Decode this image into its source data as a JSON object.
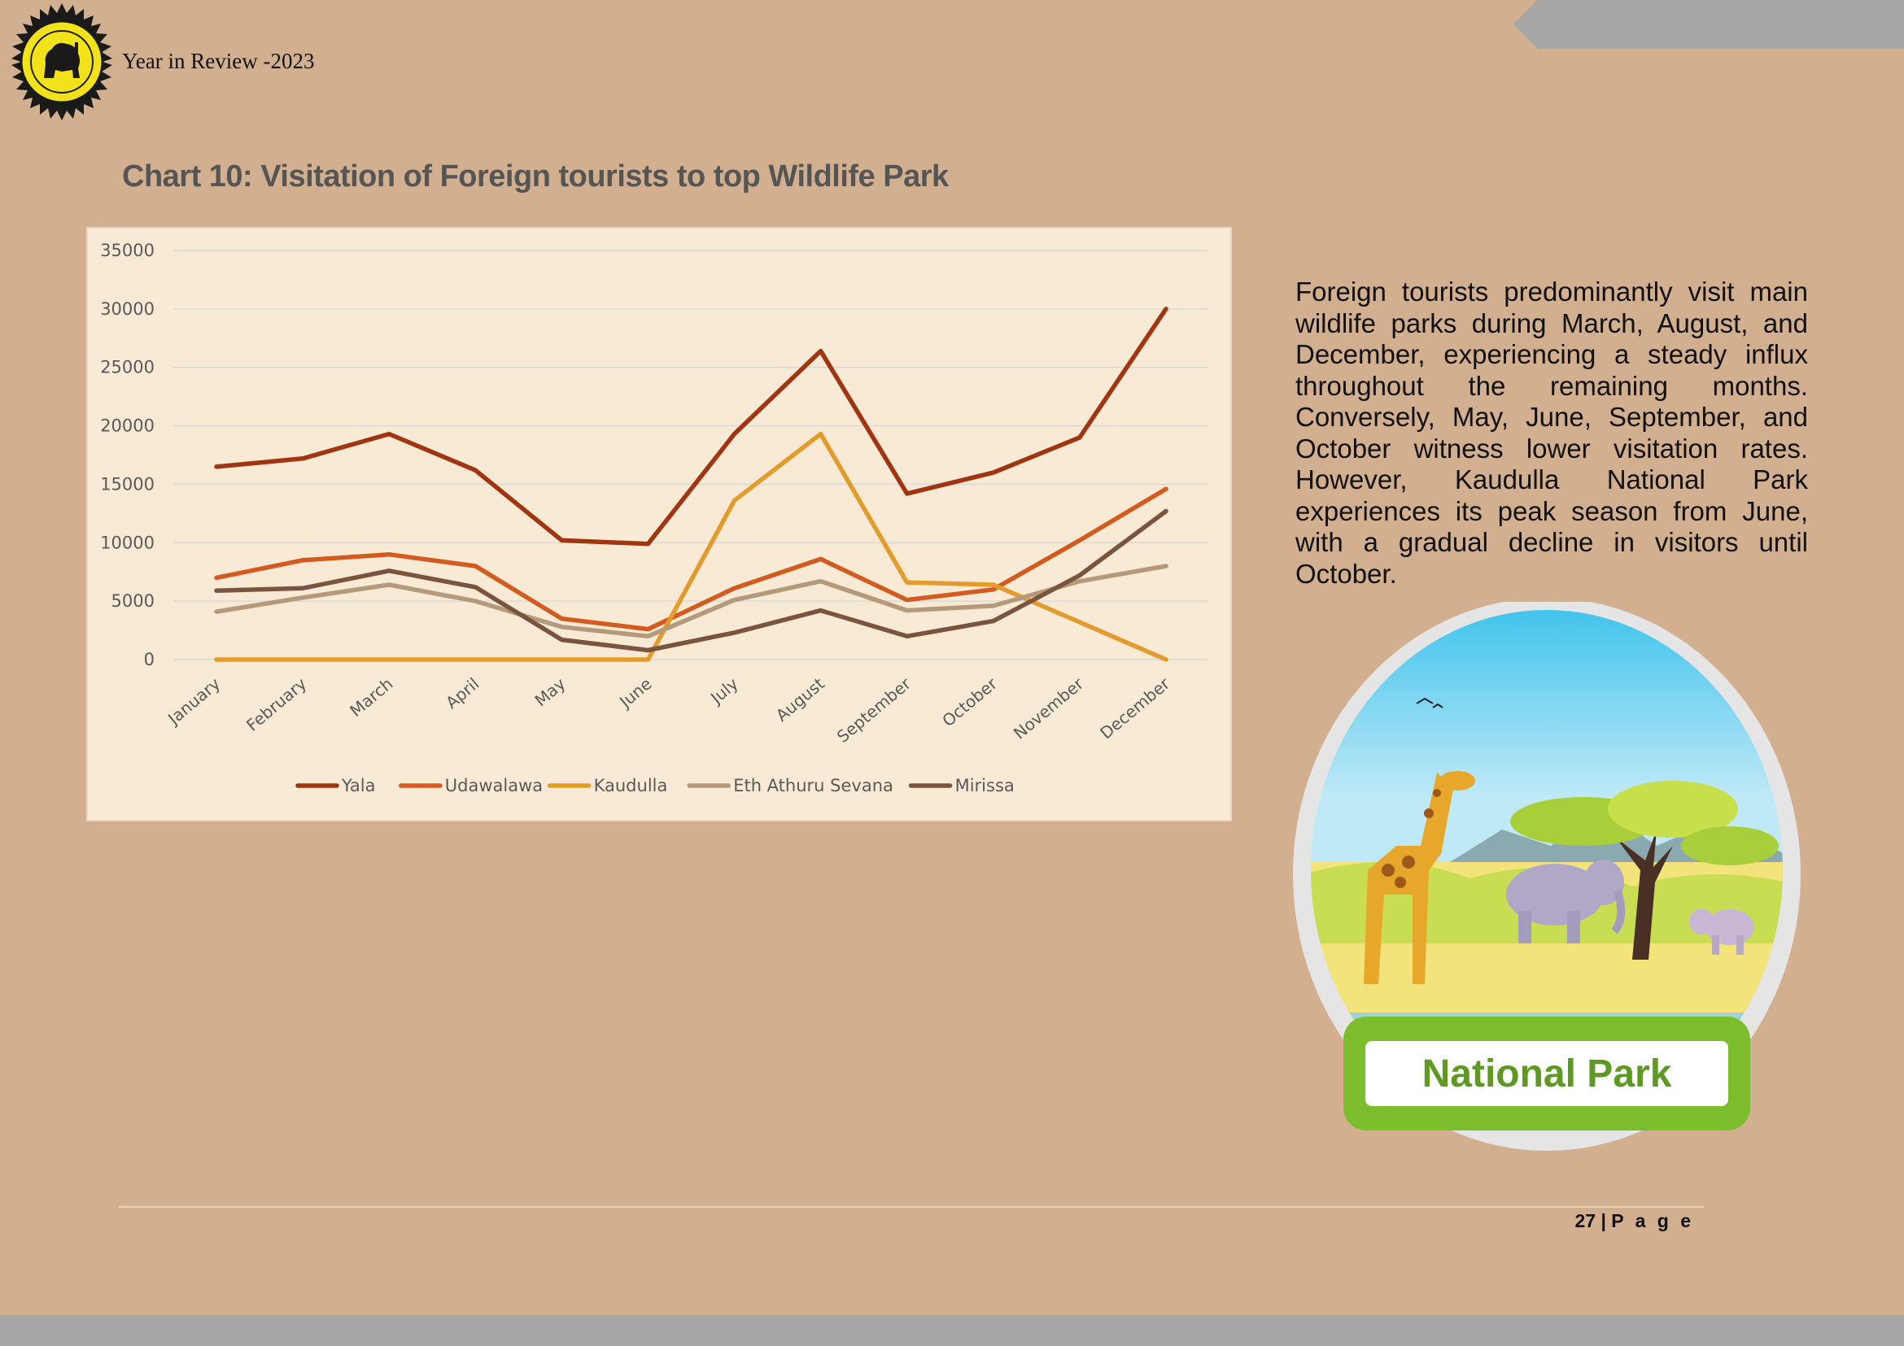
{
  "header": {
    "title": "Year in Review -2023"
  },
  "chart_title": "Chart 10: Visitation of Foreign tourists to top Wildlife Park",
  "chart_data": {
    "type": "line",
    "categories": [
      "January",
      "February",
      "March",
      "April",
      "May",
      "June",
      "July",
      "August",
      "September",
      "October",
      "November",
      "December"
    ],
    "series": [
      {
        "name": "Yala",
        "color": "#a23511",
        "values": [
          16500,
          17200,
          19300,
          16200,
          10200,
          9900,
          19300,
          26400,
          14200,
          16000,
          19000,
          30000
        ]
      },
      {
        "name": "Udawalawa",
        "color": "#d35b20",
        "values": [
          7000,
          8500,
          9000,
          8000,
          3500,
          2600,
          6100,
          8600,
          5100,
          6000,
          10200,
          14600
        ]
      },
      {
        "name": "Kaudulla",
        "color": "#e39c2b",
        "values": [
          0,
          0,
          0,
          0,
          0,
          0,
          13600,
          19300,
          6600,
          6400,
          3200,
          0
        ]
      },
      {
        "name": "Eth Athuru Sevana",
        "color": "#b4997a",
        "values": [
          4100,
          5300,
          6400,
          5000,
          2800,
          2000,
          5100,
          6700,
          4200,
          4600,
          6700,
          8000
        ]
      },
      {
        "name": "Mirissa",
        "color": "#7b5440",
        "values": [
          5900,
          6100,
          7600,
          6200,
          1700,
          800,
          2300,
          4200,
          2000,
          3300,
          7200,
          12700
        ]
      }
    ],
    "ylim": [
      0,
      35000
    ],
    "yticks": [
      0,
      5000,
      10000,
      15000,
      20000,
      25000,
      30000,
      35000
    ],
    "grid": true,
    "legend": "bottom"
  },
  "description": "Foreign tourists predominantly visit main wildlife parks during March, August, and December, experiencing a steady influx throughout the remaining months. Conversely, May, June, September, and October witness lower visitation rates. However, Kaudulla National Park experiences its peak season from June, with a gradual decline in visitors until October.",
  "badge": {
    "label": "National Park"
  },
  "footer": {
    "page_number": "27",
    "separator": "|",
    "page_word": "P a g e"
  }
}
